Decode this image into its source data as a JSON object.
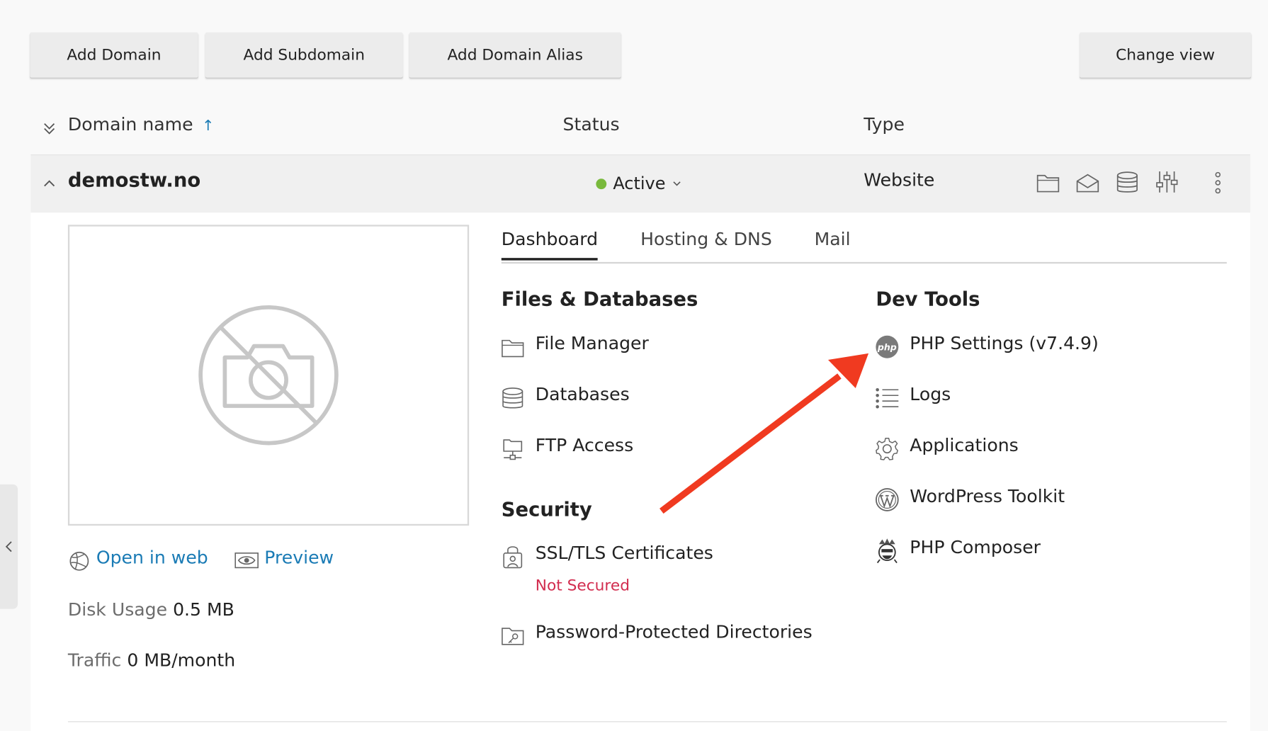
{
  "toolbar": {
    "add_domain": "Add Domain",
    "add_subdomain": "Add Subdomain",
    "add_domain_alias": "Add Domain Alias",
    "change_view": "Change view"
  },
  "table": {
    "col_domain": "Domain name",
    "col_status": "Status",
    "col_type": "Type",
    "sort_indicator": "↑"
  },
  "domain": {
    "name": "demostw.no",
    "status": "Active",
    "type": "Website",
    "open_in_web": "Open in web",
    "preview": "Preview",
    "disk_label": "Disk Usage",
    "disk_value": "0.5 MB",
    "traffic_label": "Traffic",
    "traffic_value": "0 MB/month"
  },
  "tabs": [
    "Dashboard",
    "Hosting & DNS",
    "Mail"
  ],
  "files_db": {
    "title": "Files & Databases",
    "items": [
      "File Manager",
      "Databases",
      "FTP Access"
    ]
  },
  "security": {
    "title": "Security",
    "ssl": "SSL/TLS Certificates",
    "ssl_status": "Not Secured",
    "ppd": "Password-Protected Directories"
  },
  "dev_tools": {
    "title": "Dev Tools",
    "items": [
      "PHP Settings (v7.4.9)",
      "Logs",
      "Applications",
      "WordPress Toolkit",
      "PHP Composer"
    ]
  },
  "colors": {
    "link": "#1a7bb5",
    "status_active": "#79b93c",
    "not_secured": "#d22d4f",
    "annotation_arrow": "#f03a20"
  },
  "icons": [
    "chevron-down-double-icon",
    "chevron-up-icon",
    "folder-icon",
    "mail-icon",
    "database-icon",
    "sliders-icon",
    "more-vertical-icon",
    "no-camera-icon",
    "globe-icon",
    "eye-icon",
    "ftp-icon",
    "lock-person-icon",
    "folder-key-icon",
    "php-icon",
    "list-icon",
    "gear-icon",
    "wordpress-icon",
    "composer-icon",
    "chevron-left-icon"
  ]
}
